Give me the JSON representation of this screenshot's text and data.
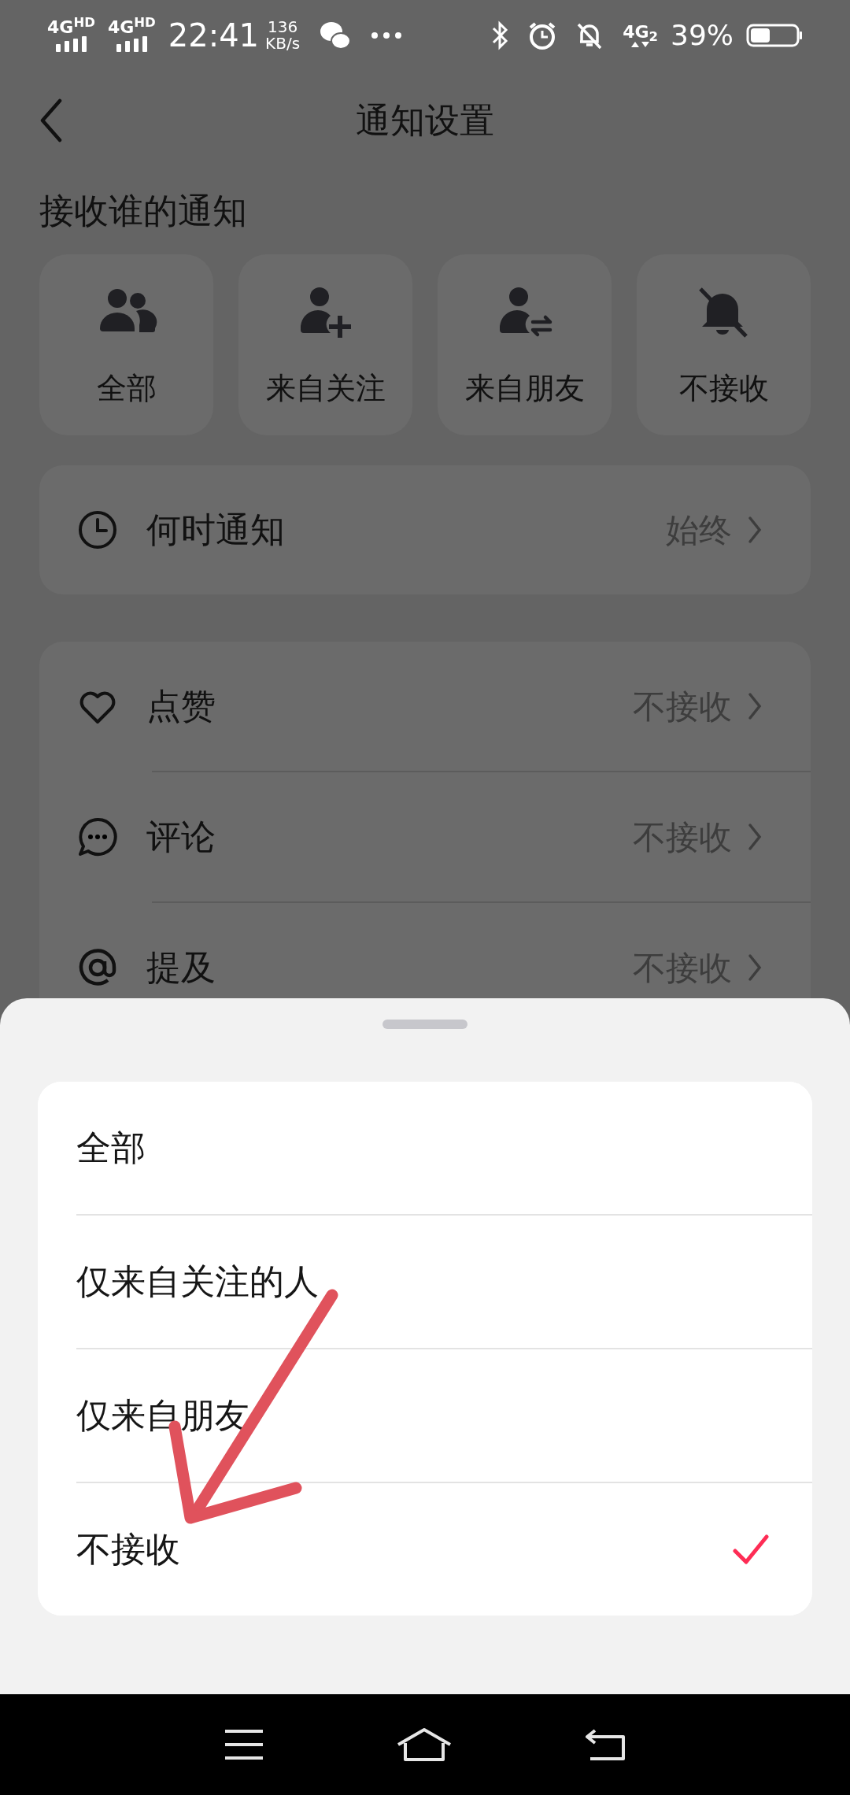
{
  "status_bar": {
    "signals": [
      "4G$^{HD}$",
      "4G$^{HD}$"
    ],
    "time": "22:41",
    "speed_value": "136",
    "speed_unit": "KB/s",
    "network": "4G$_{2}$",
    "battery": "39%"
  },
  "header": {
    "title": "通知设置"
  },
  "who_section": {
    "title": "接收谁的通知",
    "options": [
      {
        "kind": "people",
        "label": "全部"
      },
      {
        "kind": "person-add",
        "label": "来自关注"
      },
      {
        "kind": "person-swap",
        "label": "来自朋友"
      },
      {
        "kind": "bell-off",
        "label": "不接收"
      }
    ]
  },
  "when_row": {
    "label": "何时通知",
    "value": "始终"
  },
  "settings": [
    {
      "kind": "heart",
      "label": "点赞",
      "value": "不接收"
    },
    {
      "kind": "comment",
      "label": "评论",
      "value": "不接收"
    },
    {
      "kind": "mention",
      "label": "提及",
      "value": "不接收"
    }
  ],
  "sheet": {
    "options": [
      {
        "label": "全部",
        "selected": false
      },
      {
        "label": "仅来自关注的人",
        "selected": false
      },
      {
        "label": "仅来自朋友",
        "selected": false
      },
      {
        "label": "不接收",
        "selected": true
      }
    ]
  }
}
